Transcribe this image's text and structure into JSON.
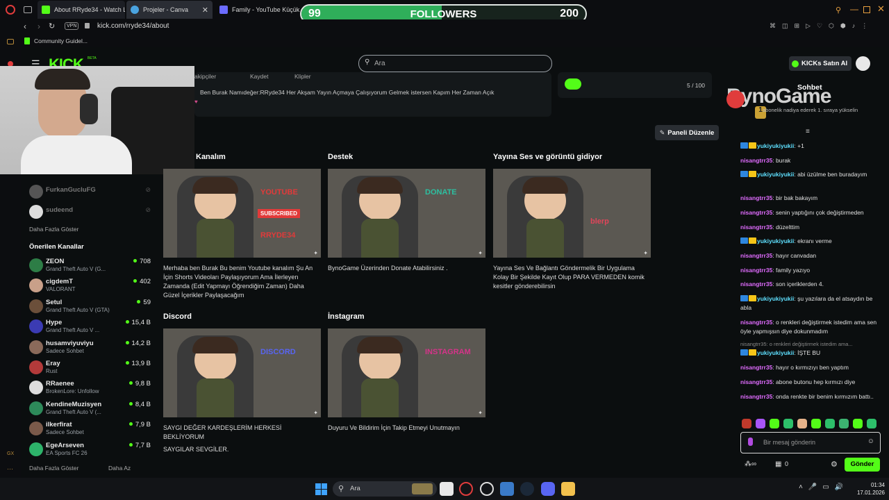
{
  "browser": {
    "tabs": [
      {
        "label": "About RRyde34 - Watch L",
        "color": "#53fc18"
      },
      {
        "label": "Projeler - Canva",
        "color": "#7d2ae8"
      },
      {
        "label": "Family - YouTube Küçük F",
        "color": "#6b6bff"
      }
    ],
    "vpn": "VPN",
    "url": "kick.com/rryde34/about",
    "bookmark": "Community Guidel..."
  },
  "followers": {
    "current": "99",
    "label": "FOLLOWERS",
    "goal": "200",
    "progress": 0.495
  },
  "kick": {
    "logo": "KICK",
    "beta": "BETA",
    "search_placeholder": "Ara",
    "buy_kicks": "KICKs Satın Al"
  },
  "about": {
    "desc_fragment": "Ben Burak Namıdeğer:RRyde34 Her Akşam Yayın Açmaya Çalışıyorum Gelmek istersen Kapım Her Zaman Açık",
    "goal": "5 / 100",
    "edit_panel": "Paneli Düzenle",
    "top_fragments": [
      "akipçiler",
      "Kaydet",
      "Klipler"
    ]
  },
  "sidebar": {
    "followed": [
      {
        "name": "FurkanGucluFG"
      },
      {
        "name": "sudeend"
      }
    ],
    "show_more": "Daha Fazla Göster",
    "recommended_title": "Önerilen Kanallar",
    "recommended": [
      {
        "name": "ZEON",
        "game": "Grand Theft Auto V (G...",
        "count": "708",
        "color": "#2d7d46"
      },
      {
        "name": "cigdemT",
        "game": "VALORANT",
        "count": "402",
        "color": "#c9a089"
      },
      {
        "name": "Setul",
        "game": "Grand Theft Auto V (GTA)",
        "count": "59",
        "color": "#6b4f3a"
      },
      {
        "name": "Hype",
        "game": "Grand Theft Auto V ...",
        "count": "15,4 B",
        "color": "#3b3bb3"
      },
      {
        "name": "husamviyuviyu",
        "game": "Sadece Sohbet",
        "count": "14,2 B",
        "color": "#8a6a5a"
      },
      {
        "name": "Eray",
        "game": "Rust",
        "count": "13,9 B",
        "color": "#b33a3a"
      },
      {
        "name": "RRaenee",
        "game": "BrokenLore: Unfollow",
        "count": "9,8 B",
        "color": "#dddddd"
      },
      {
        "name": "KendineMuzisyen",
        "game": "Grand Theft Auto V (...",
        "count": "8,4 B",
        "color": "#2d8a5a"
      },
      {
        "name": "ilkerfirat",
        "game": "Sadece Sohbet",
        "count": "7,9 B",
        "color": "#7a5a4a"
      },
      {
        "name": "EgeArseven",
        "game": "EA Sports FC 26",
        "count": "7,7 B",
        "color": "#2db36a"
      }
    ],
    "show_more2": "Daha Fazla Göster",
    "show_less": "Daha Az"
  },
  "panels": [
    {
      "title": "Kanalım",
      "overlay": "YOUTUBE",
      "overlay2": "SUBSCRIBED",
      "overlay3": "RRYDE34",
      "desc": "Merhaba ben Burak Bu benim Youtube kanalım Şu An İçin Shorts Videoları Paylaşıyorum Ama İlerleyen Zamanda (Edit Yapmayı Öğrendiğim Zaman) Daha Güzel İçerikler Paylaşacağım"
    },
    {
      "title": "Destek",
      "overlay": "DONATE",
      "desc": "BynoGame Üzerinden Donate Atabilirsiniz ."
    },
    {
      "title": "Yayına Ses ve görüntü gidiyor",
      "overlay": "blerp",
      "desc": "Yayına Ses Ve Bağlantı Göndermelik Bir Uygulama Kolay Bir Şekilde Kayıt Olup PARA VERMEDEN komik kesitler gönderebilirsin"
    },
    {
      "title": "Discord",
      "overlay": "DISCORD",
      "desc": "SAYGI DEĞER KARDEŞLERİM HERKESİ BEKLİYORUM",
      "desc2": "SAYGILAR SEVGİLER."
    },
    {
      "title": "İnstagram",
      "overlay": "INSTAGRAM",
      "desc": "Duyuru Ve Bildirim İçin Takip Etmeyi Unutmayın"
    }
  ],
  "chat": {
    "title": "Sohbet",
    "watermark": "BynoGame",
    "sub_notice": "abonelik nadiya ederek 1. sıraya yükselin",
    "rank": "1",
    "messages": [
      {
        "user": "yukiyukiyukii",
        "text": "+1",
        "type": "y"
      },
      {
        "user": "nisangtrr35",
        "text": "burak",
        "type": "n"
      },
      {
        "user": "yukiyukiyukii",
        "text": "abi üzülme ben buradayım",
        "type": "y"
      },
      {
        "user": "nisangtrr35",
        "text": "bir bak bakayım",
        "type": "n"
      },
      {
        "user": "nisangtrr35",
        "text": "senin yaptığını çok değiştirmeden",
        "type": "n"
      },
      {
        "user": "nisangtrr35",
        "text": "düzelttim",
        "type": "n"
      },
      {
        "user": "yukiyukiyukii",
        "text": "ekranı verme",
        "type": "y"
      },
      {
        "user": "nisangtrr35",
        "text": "hayır canvadan",
        "type": "n"
      },
      {
        "user": "nisangtrr35",
        "text": "family yazıyo",
        "type": "n"
      },
      {
        "user": "nisangtrr35",
        "text": "son içeriklerden 4.",
        "type": "n"
      },
      {
        "user": "yukiyukiyukii",
        "text": "şu yazılara da el atsaydın be abla",
        "type": "y"
      },
      {
        "user": "nisangtrr35",
        "text": "o renkleri değiştirmek istedim ama sen öyle yapmışsın diye dokunmadım",
        "type": "n"
      },
      {
        "user": "yukiyukiyukii",
        "text": "İŞTE BU",
        "type": "y"
      },
      {
        "user": "nisangtrr35",
        "text": "hayır o kırmızıyı ben yaptım",
        "type": "n"
      },
      {
        "user": "nisangtrr35",
        "text": "abone butonu hep kırmızı diye",
        "type": "n"
      },
      {
        "user": "nisangtrr35",
        "text": "onda renkte bir benim kırmızım battı..",
        "type": "n"
      }
    ],
    "reply_preview": "nisangtrr35: o renkleri değiştirmek istedim ama...",
    "input_placeholder": "Bir mesaj gönderin",
    "points": "0",
    "send": "Gönder"
  },
  "taskbar": {
    "search": "Ara",
    "time": "01:34",
    "date": "17.01.2026"
  }
}
